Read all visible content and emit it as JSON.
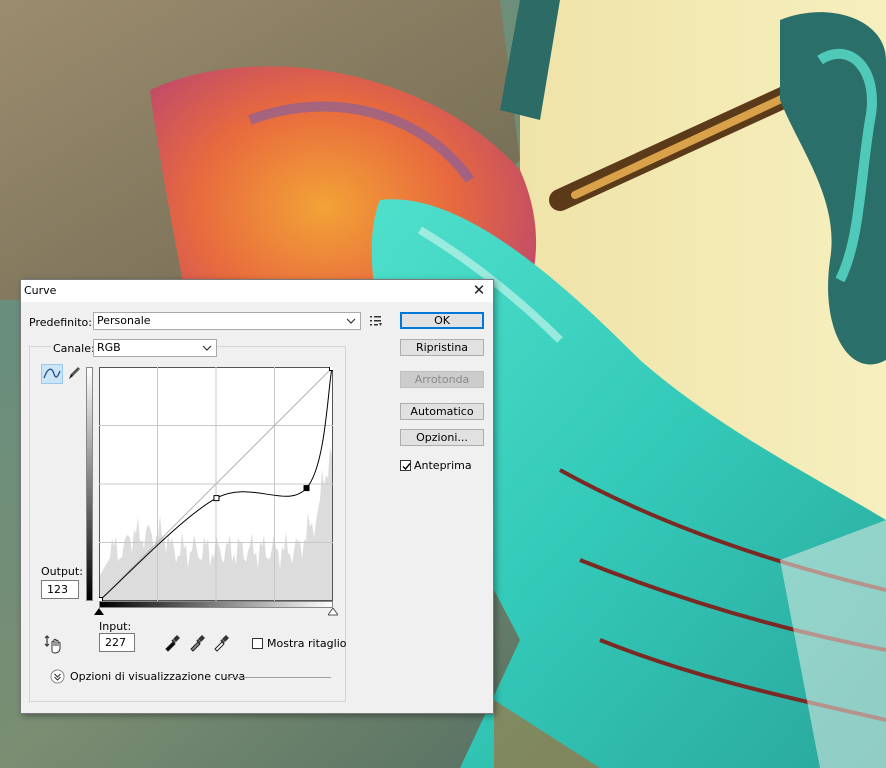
{
  "dialog": {
    "title": "Curve",
    "close_glyph": "✕",
    "preset_label": "Predefinito:",
    "preset_value": "Personale",
    "preset_menu_icon": "list-menu-icon",
    "channel_label": "Canale:",
    "channel_value": "RGB",
    "output_label": "Output:",
    "output_value": "123",
    "input_label": "Input:",
    "input_value": "227",
    "show_clipping_label": "Mostra ritaglio",
    "show_clipping_checked": false,
    "curve_display_options_label": "Opzioni di visualizzazione curva",
    "buttons": {
      "ok": "OK",
      "reset": "Ripristina",
      "smooth": "Arrotonda",
      "auto": "Automatico",
      "options": "Opzioni..."
    },
    "preview_label": "Anteprima",
    "preview_checked": true,
    "curve": {
      "points": [
        [
          0,
          0
        ],
        [
          128,
          112
        ],
        [
          227,
          123
        ],
        [
          255,
          255
        ]
      ],
      "selected_point_input": 227
    },
    "icons": {
      "curve_tool": "curve-point-icon",
      "pencil_tool": "pencil-icon",
      "targeted_adjust": "hand-adjust-icon",
      "black_eyedropper": "eyedropper-black-icon",
      "gray_eyedropper": "eyedropper-gray-icon",
      "white_eyedropper": "eyedropper-white-icon",
      "expand": "expand-chevron-icon"
    },
    "accent_color": "#0078d7"
  }
}
